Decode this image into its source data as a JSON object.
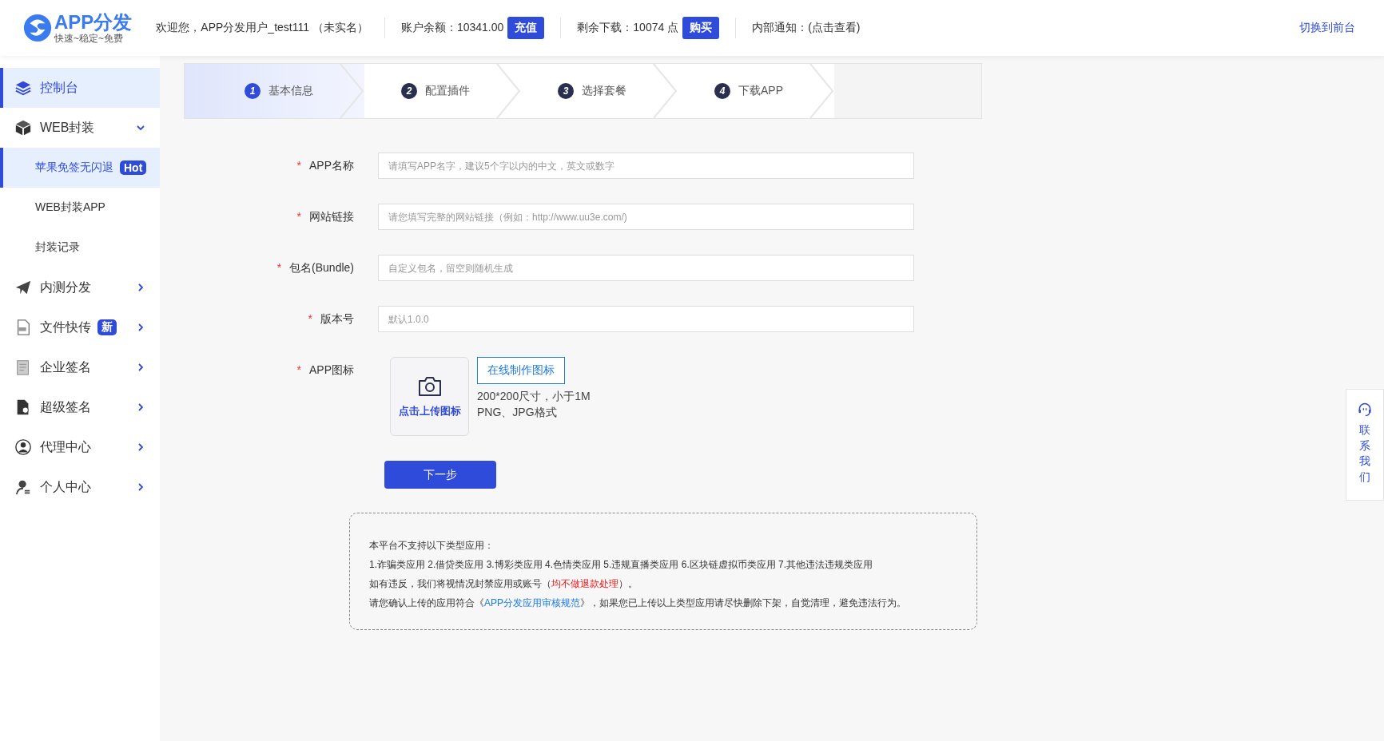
{
  "header": {
    "logo": {
      "title": "APP分发",
      "slogan": "快速~稳定~免费"
    },
    "welcome": "欢迎您，APP分发用户_test111 （未实名）",
    "balance": {
      "label": "账户余额：10341.00",
      "button": "充值"
    },
    "downloads": {
      "label": "剩余下载：10074 点",
      "button": "购买"
    },
    "notice": "内部通知：(点击查看)",
    "switch_link": "切换到前台"
  },
  "sidebar": {
    "items": [
      {
        "label": "控制台",
        "selected": true
      },
      {
        "label": "WEB封装",
        "selected": false,
        "expanded": true,
        "children": [
          {
            "label": "苹果免签无闪退",
            "badge": "Hot",
            "selected": true
          },
          {
            "label": "WEB封装APP",
            "selected": false
          },
          {
            "label": "封装记录",
            "selected": false
          }
        ]
      },
      {
        "label": "内测分发",
        "selected": false,
        "expanded": false
      },
      {
        "label": "文件快传",
        "badge": "新",
        "selected": false,
        "expanded": false
      },
      {
        "label": "企业签名",
        "selected": false,
        "expanded": false
      },
      {
        "label": "超级签名",
        "selected": false,
        "expanded": false
      },
      {
        "label": "代理中心",
        "selected": false,
        "expanded": false
      },
      {
        "label": "个人中心",
        "selected": false,
        "expanded": false
      }
    ]
  },
  "steps": [
    {
      "number": "1",
      "label": "基本信息",
      "selected": true
    },
    {
      "number": "2",
      "label": "配置插件",
      "selected": false
    },
    {
      "number": "3",
      "label": "选择套餐",
      "selected": false
    },
    {
      "number": "4",
      "label": "下载APP",
      "selected": false
    }
  ],
  "form": {
    "fields": [
      {
        "kind": "text",
        "mark": "*",
        "label": "APP名称",
        "placeholder": "请填写APP名字，建议5个字以内的中文，英文或数字"
      },
      {
        "kind": "text",
        "mark": "*",
        "label": "网站链接",
        "placeholder": "请您填写完整的网站链接（例如：http://www.uu3e.com/)"
      },
      {
        "kind": "text",
        "mark": "*",
        "label": "包名(Bundle)",
        "placeholder": "自定义包名，留空则随机生成"
      },
      {
        "kind": "text",
        "mark": "*",
        "label": "版本号",
        "placeholder": "默认1.0.0"
      },
      {
        "kind": "upload",
        "mark": "*",
        "label": "APP图标",
        "upload_label": "点击上传图标",
        "make_button": "在线制作图标",
        "hints": [
          "200*200尺寸，小于1M",
          "PNG、JPG格式"
        ]
      }
    ],
    "next_button": "下一步"
  },
  "notice_box": {
    "lines": [
      [
        {
          "kind": "plain",
          "text": "本平台不支持以下类型应用："
        }
      ],
      [
        {
          "kind": "plain",
          "text": "1.诈骗类应用 2.借贷类应用 3.博彩类应用 4.色情类应用 5.违规直播类应用 6.区块链虚拟币类应用 7.其他违法违规类应用"
        }
      ],
      [
        {
          "kind": "plain",
          "text": "如有违反，我们将视情况封禁应用或账号（"
        },
        {
          "kind": "warning",
          "text": "均不做退款处理"
        },
        {
          "kind": "plain",
          "text": "）。"
        }
      ],
      [
        {
          "kind": "plain",
          "text": "请您确认上传的应用符合《"
        },
        {
          "kind": "link",
          "text": "APP分发应用审核规范"
        },
        {
          "kind": "plain",
          "text": "》，如果您已上传以上类型应用请尽快删除下架，自觉清理，避免违法行为。"
        }
      ]
    ]
  },
  "contact": {
    "label": "联系我们"
  }
}
